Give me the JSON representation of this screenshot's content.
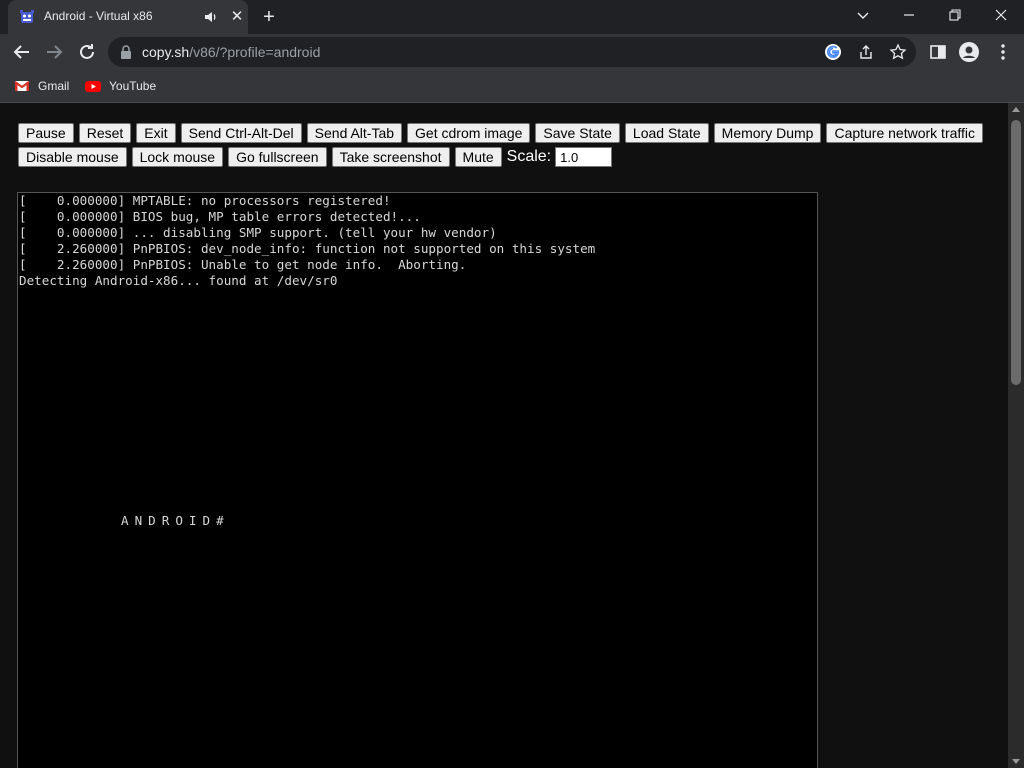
{
  "browser": {
    "tab": {
      "title": "Android - Virtual x86",
      "favicon": "v86-logo-icon"
    },
    "url": {
      "host": "copy.sh",
      "path": "/v86/?profile=android"
    },
    "bookmarks": [
      {
        "label": "Gmail",
        "icon": "gmail-icon"
      },
      {
        "label": "YouTube",
        "icon": "youtube-icon"
      }
    ]
  },
  "controls": {
    "row1": [
      "Pause",
      "Reset",
      "Exit",
      "Send Ctrl-Alt-Del",
      "Send Alt-Tab",
      "Get cdrom image",
      "Save State",
      "Load State",
      "Memory Dump",
      "Capture network traffic"
    ],
    "row2": [
      "Disable mouse",
      "Lock mouse",
      "Go fullscreen",
      "Take screenshot",
      "Mute"
    ],
    "scale_label": "Scale:",
    "scale_value": "1.0"
  },
  "console": {
    "lines": [
      "[    0.000000] MPTABLE: no processors registered!",
      "[    0.000000] BIOS bug, MP table errors detected!...",
      "[    0.000000] ... disabling SMP support. (tell your hw vendor)",
      "[    2.260000] PnPBIOS: dev_node_info: function not supported on this system",
      "[    2.260000] PnPBIOS: Unable to get node info.  Aborting.",
      "Detecting Android-x86... found at /dev/sr0"
    ],
    "prompt": "ANDROID#"
  },
  "colors": {
    "accent": "#efefef",
    "screen_bg": "#000000",
    "chrome_bg": "#35363a"
  }
}
